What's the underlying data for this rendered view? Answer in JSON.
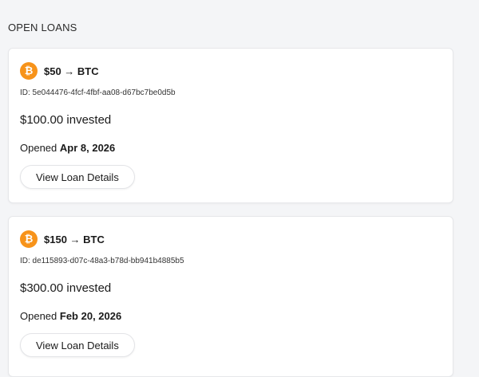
{
  "section": {
    "title": "OPEN LOANS"
  },
  "colors": {
    "btc_accent": "#f7931a"
  },
  "loans": [
    {
      "icon": "bitcoin-icon",
      "icon_glyph": "₿",
      "amount_label": "$50 → BTC",
      "id_label": "ID: 5e044476-4fcf-4fbf-aa08-d67bc7be0d5b",
      "invested_label": "$100.00 invested",
      "opened_prefix": "Opened",
      "opened_date": "Apr 8, 2026",
      "button_label": "View Loan Details"
    },
    {
      "icon": "bitcoin-icon",
      "icon_glyph": "₿",
      "amount_label": "$150 → BTC",
      "id_label": "ID: de115893-d07c-48a3-b78d-bb941b4885b5",
      "invested_label": "$300.00 invested",
      "opened_prefix": "Opened",
      "opened_date": "Feb 20, 2026",
      "button_label": "View Loan Details"
    }
  ]
}
